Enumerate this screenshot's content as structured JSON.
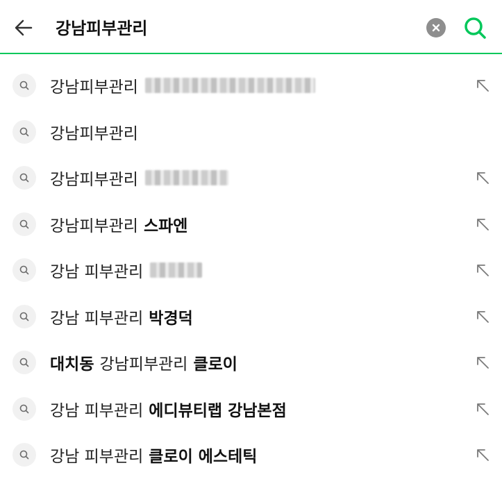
{
  "header": {
    "query": "강남피부관리",
    "accent_color": "#03c75a",
    "back_icon": "arrow-left-icon",
    "clear_icon": "clear-circle-x-icon",
    "search_icon": "search-magnifier-icon"
  },
  "suggestions": [
    {
      "prefix": "",
      "base": "강남피부관리",
      "suffix": "",
      "masked": true,
      "has_arrow": true
    },
    {
      "prefix": "",
      "base": "강남피부관리",
      "suffix": "",
      "masked": false,
      "has_arrow": false
    },
    {
      "prefix": "",
      "base": "강남피부관리",
      "suffix": "",
      "masked": true,
      "has_arrow": true
    },
    {
      "prefix": "",
      "base": "강남피부관리",
      "suffix": "스파엔",
      "masked": false,
      "has_arrow": true
    },
    {
      "prefix": "",
      "base": "강남 피부관리",
      "suffix": "",
      "masked": true,
      "has_arrow": true
    },
    {
      "prefix": "",
      "base": "강남 피부관리",
      "suffix": "박경덕",
      "masked": false,
      "has_arrow": true
    },
    {
      "prefix": "대치동",
      "base": "강남피부관리",
      "suffix": "클로이",
      "masked": false,
      "has_arrow": true
    },
    {
      "prefix": "",
      "base": "강남 피부관리",
      "suffix": "에디뷰티랩 강남본점",
      "masked": false,
      "has_arrow": true
    },
    {
      "prefix": "",
      "base": "강남 피부관리",
      "suffix": "클로이 에스테틱",
      "masked": false,
      "has_arrow": true
    }
  ],
  "icons": {
    "suggestion_icon": "search-small-icon",
    "arrow_icon": "arrow-up-left-icon"
  }
}
